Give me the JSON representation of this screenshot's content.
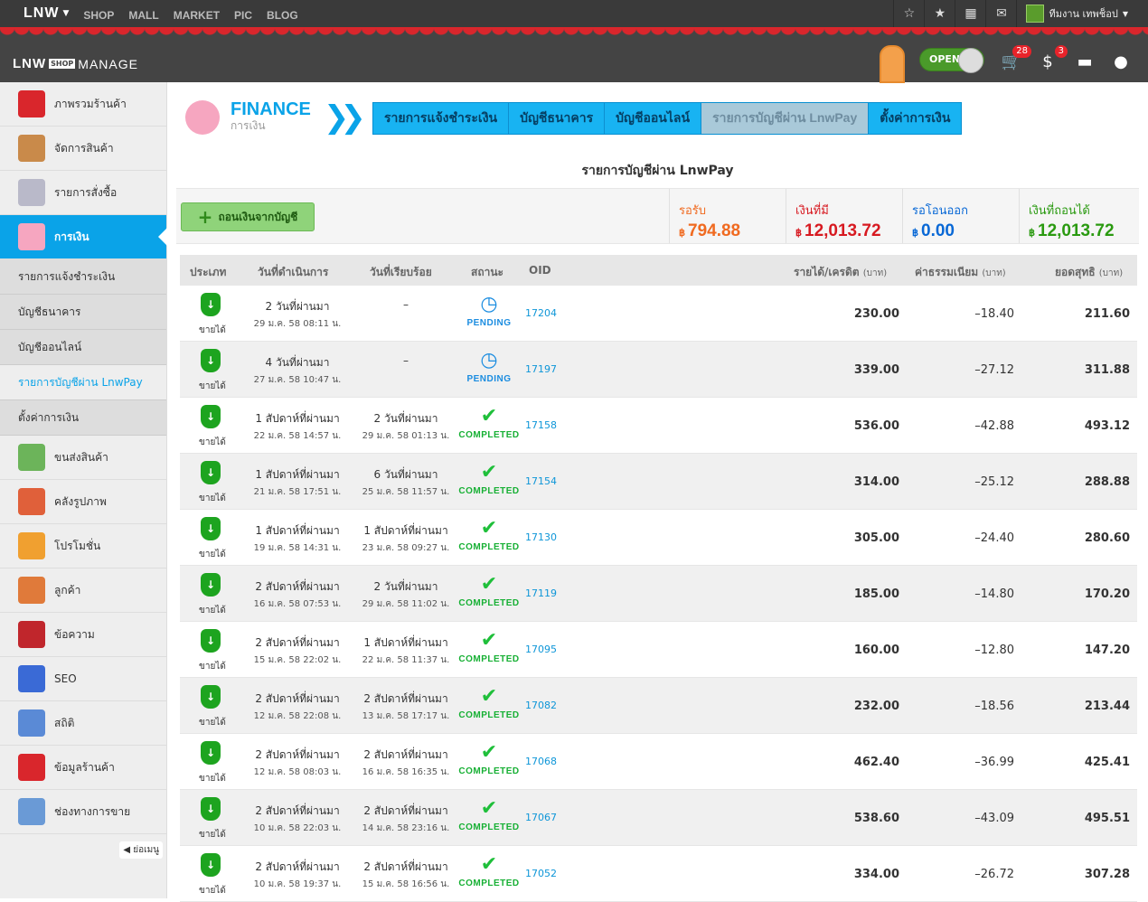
{
  "topbar": {
    "logo": "LNW",
    "nav": [
      "SHOP",
      "MALL",
      "MARKET",
      "PIC",
      "BLOG"
    ],
    "user": "ทีมงาน เทพช็อป"
  },
  "manage": {
    "logo_l": "LNW",
    "logo_shop": "SHOP",
    "logo_manage": "MANAGE",
    "toggle": "OPEN",
    "cart_badge": "28",
    "money_badge": "3"
  },
  "sidebar": {
    "items_top": [
      {
        "label": "ภาพรวมร้านค้า",
        "color": "#d9262c"
      },
      {
        "label": "จัดการสินค้า",
        "color": "#c98a4a"
      },
      {
        "label": "รายการสั่งซื้อ",
        "color": "#b9b9c9"
      },
      {
        "label": "การเงิน",
        "color": "#f6a6c0"
      }
    ],
    "subs": [
      "รายการแจ้งชำระเงิน",
      "บัญชีธนาคาร",
      "บัญชีออนไลน์",
      "รายการบัญชีผ่าน LnwPay",
      "ตั้งค่าการเงิน"
    ],
    "items_bottom": [
      {
        "label": "ขนส่งสินค้า",
        "color": "#6cb45a"
      },
      {
        "label": "คลังรูปภาพ",
        "color": "#e0603a"
      },
      {
        "label": "โปรโมชั่น",
        "color": "#f0a030"
      },
      {
        "label": "ลูกค้า",
        "color": "#e07a3a"
      },
      {
        "label": "ข้อความ",
        "color": "#c0262c"
      },
      {
        "label": "SEO",
        "color": "#3a6ad6"
      },
      {
        "label": "สถิติ",
        "color": "#5a8ad6"
      },
      {
        "label": "ข้อมูลร้านค้า",
        "color": "#d9262c"
      },
      {
        "label": "ช่องทางการขาย",
        "color": "#6a9ad6"
      }
    ],
    "collapse": "ย่อเมนู"
  },
  "finance": {
    "title": "FINANCE",
    "subtitle": "การเงิน"
  },
  "tabs": [
    "รายการแจ้งชำระเงิน",
    "บัญชีธนาคาร",
    "บัญชีออนไลน์",
    "รายการบัญชีผ่าน LnwPay",
    "ตั้งค่าการเงิน"
  ],
  "page_title": "รายการบัญชีผ่าน LnwPay",
  "withdraw_button": "ถอนเงินจากบัญชี",
  "summary": [
    {
      "label": "รอรับ",
      "value": "794.88",
      "currency": "฿",
      "color": "#f06a20"
    },
    {
      "label": "เงินที่มี",
      "value": "12,013.72",
      "currency": "฿",
      "color": "#d71920"
    },
    {
      "label": "รอโอนออก",
      "value": "0.00",
      "currency": "฿",
      "color": "#0868d6"
    },
    {
      "label": "เงินที่ถอนได้",
      "value": "12,013.72",
      "currency": "฿",
      "color": "#2a9a10"
    }
  ],
  "columns": {
    "type": "ประเภท",
    "date_op": "วันที่ดำเนินการ",
    "date_done": "วันที่เรียบร้อย",
    "status": "สถานะ",
    "oid": "OID",
    "income": "รายได้/เครดิต",
    "fee": "ค่าธรรมเนียม",
    "net": "ยอดสุทธิ",
    "unit": "(บาท)"
  },
  "rows": [
    {
      "type": "ขายได้",
      "op_rel": "2 วันที่ผ่านมา",
      "op_abs": "29 ม.ค. 58 08:11 น.",
      "done_rel": "–",
      "done_abs": "",
      "status": "PENDING",
      "oid": "17204",
      "income": "230.00",
      "fee": "–18.40",
      "net": "211.60"
    },
    {
      "type": "ขายได้",
      "op_rel": "4 วันที่ผ่านมา",
      "op_abs": "27 ม.ค. 58 10:47 น.",
      "done_rel": "–",
      "done_abs": "",
      "status": "PENDING",
      "oid": "17197",
      "income": "339.00",
      "fee": "–27.12",
      "net": "311.88"
    },
    {
      "type": "ขายได้",
      "op_rel": "1 สัปดาห์ที่ผ่านมา",
      "op_abs": "22 ม.ค. 58 14:57 น.",
      "done_rel": "2 วันที่ผ่านมา",
      "done_abs": "29 ม.ค. 58 01:13 น.",
      "status": "COMPLETED",
      "oid": "17158",
      "income": "536.00",
      "fee": "–42.88",
      "net": "493.12"
    },
    {
      "type": "ขายได้",
      "op_rel": "1 สัปดาห์ที่ผ่านมา",
      "op_abs": "21 ม.ค. 58 17:51 น.",
      "done_rel": "6 วันที่ผ่านมา",
      "done_abs": "25 ม.ค. 58 11:57 น.",
      "status": "COMPLETED",
      "oid": "17154",
      "income": "314.00",
      "fee": "–25.12",
      "net": "288.88"
    },
    {
      "type": "ขายได้",
      "op_rel": "1 สัปดาห์ที่ผ่านมา",
      "op_abs": "19 ม.ค. 58 14:31 น.",
      "done_rel": "1 สัปดาห์ที่ผ่านมา",
      "done_abs": "23 ม.ค. 58 09:27 น.",
      "status": "COMPLETED",
      "oid": "17130",
      "income": "305.00",
      "fee": "–24.40",
      "net": "280.60"
    },
    {
      "type": "ขายได้",
      "op_rel": "2 สัปดาห์ที่ผ่านมา",
      "op_abs": "16 ม.ค. 58 07:53 น.",
      "done_rel": "2 วันที่ผ่านมา",
      "done_abs": "29 ม.ค. 58 11:02 น.",
      "status": "COMPLETED",
      "oid": "17119",
      "income": "185.00",
      "fee": "–14.80",
      "net": "170.20"
    },
    {
      "type": "ขายได้",
      "op_rel": "2 สัปดาห์ที่ผ่านมา",
      "op_abs": "15 ม.ค. 58 22:02 น.",
      "done_rel": "1 สัปดาห์ที่ผ่านมา",
      "done_abs": "22 ม.ค. 58 11:37 น.",
      "status": "COMPLETED",
      "oid": "17095",
      "income": "160.00",
      "fee": "–12.80",
      "net": "147.20"
    },
    {
      "type": "ขายได้",
      "op_rel": "2 สัปดาห์ที่ผ่านมา",
      "op_abs": "12 ม.ค. 58 22:08 น.",
      "done_rel": "2 สัปดาห์ที่ผ่านมา",
      "done_abs": "13 ม.ค. 58 17:17 น.",
      "status": "COMPLETED",
      "oid": "17082",
      "income": "232.00",
      "fee": "–18.56",
      "net": "213.44"
    },
    {
      "type": "ขายได้",
      "op_rel": "2 สัปดาห์ที่ผ่านมา",
      "op_abs": "12 ม.ค. 58 08:03 น.",
      "done_rel": "2 สัปดาห์ที่ผ่านมา",
      "done_abs": "16 ม.ค. 58 16:35 น.",
      "status": "COMPLETED",
      "oid": "17068",
      "income": "462.40",
      "fee": "–36.99",
      "net": "425.41"
    },
    {
      "type": "ขายได้",
      "op_rel": "2 สัปดาห์ที่ผ่านมา",
      "op_abs": "10 ม.ค. 58 22:03 น.",
      "done_rel": "2 สัปดาห์ที่ผ่านมา",
      "done_abs": "14 ม.ค. 58 23:16 น.",
      "status": "COMPLETED",
      "oid": "17067",
      "income": "538.60",
      "fee": "–43.09",
      "net": "495.51"
    },
    {
      "type": "ขายได้",
      "op_rel": "2 สัปดาห์ที่ผ่านมา",
      "op_abs": "10 ม.ค. 58 19:37 น.",
      "done_rel": "2 สัปดาห์ที่ผ่านมา",
      "done_abs": "15 ม.ค. 58 16:56 น.",
      "status": "COMPLETED",
      "oid": "17052",
      "income": "334.00",
      "fee": "–26.72",
      "net": "307.28"
    }
  ]
}
